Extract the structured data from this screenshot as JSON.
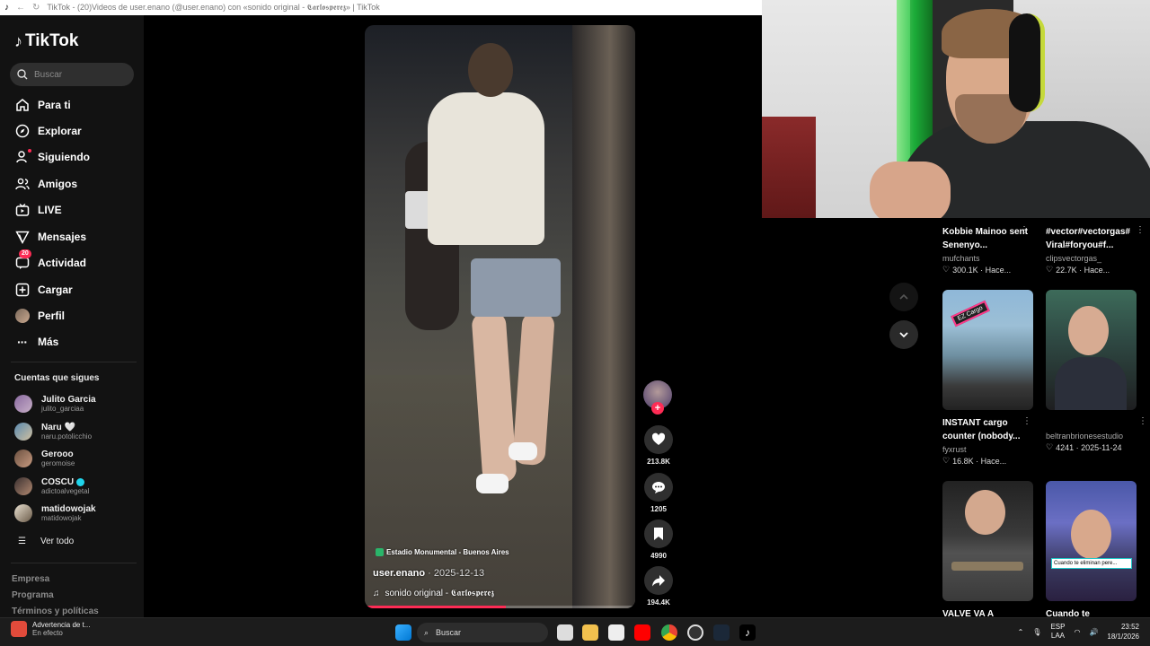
{
  "browser": {
    "title": "TikTok - (20)Videos de user.enano (@user.enano) con «sonido original - 𝕮𝖆𝖗𝖑𝖔𝖘𝖕𝖊𝖗𝖊𝖟» | TikTok"
  },
  "sidebar": {
    "logo": "TikTok",
    "search_placeholder": "Buscar",
    "nav": [
      {
        "label": "Para ti",
        "icon": "home-icon"
      },
      {
        "label": "Explorar",
        "icon": "compass-icon"
      },
      {
        "label": "Siguiendo",
        "icon": "user-follow-icon"
      },
      {
        "label": "Amigos",
        "icon": "friends-icon"
      },
      {
        "label": "LIVE",
        "icon": "live-tv-icon"
      },
      {
        "label": "Mensajes",
        "icon": "send-icon"
      },
      {
        "label": "Actividad",
        "icon": "activity-icon",
        "badge": "20"
      },
      {
        "label": "Cargar",
        "icon": "upload-plus-icon"
      },
      {
        "label": "Perfil",
        "icon": "profile-avatar-icon"
      },
      {
        "label": "Más",
        "icon": "more-dots-icon"
      }
    ],
    "following_title": "Cuentas que sigues",
    "following": [
      {
        "name": "Julito Garcia",
        "user": "julito_garciaa"
      },
      {
        "name": "Naru 🤍",
        "user": "naru.potolicchio"
      },
      {
        "name": "Gerooo",
        "user": "geromoise"
      },
      {
        "name": "COSCU",
        "user": "adictoalvegetal",
        "verified": true
      },
      {
        "name": "matidowojak",
        "user": "matidowojak"
      }
    ],
    "see_all": "Ver todo",
    "footer": [
      "Empresa",
      "Programa",
      "Términos y políticas"
    ]
  },
  "video": {
    "location": "Estadio Monumental - Buenos Aires",
    "username": "user.enano",
    "date": " · 2025-12-13",
    "sound": "sonido original - 𝕮𝖆𝖗𝖑𝖔𝖘𝖕𝖊𝖗𝖊𝖟",
    "progress": 0.52
  },
  "actions": {
    "likes": "213.8K",
    "comments": "1205",
    "saves": "4990",
    "shares": "194.4K"
  },
  "grid": [
    {
      "title": "Kobbie Mainoo sent Senenyo...",
      "user": "mufchants",
      "stats": "300.1K · Hace..."
    },
    {
      "title": "#vector#vectorgas#Viral#foryou#f...",
      "user": "clipsvectorgas_",
      "stats": "22.7K · Hace..."
    },
    {
      "title": "INSTANT cargo counter (nobody...",
      "user": "fyxrust",
      "stats": "16.8K · Hace...",
      "overlay": "EZ Cargo"
    },
    {
      "title": "",
      "user": "beltranbrionesestudio",
      "stats": "4241 · 2025-11-24"
    },
    {
      "title": "VALVE VA A",
      "user": "",
      "stats": ""
    },
    {
      "title": "Cuando te",
      "user": "",
      "stats": "",
      "overlay": "Cuando te eliminan pere..."
    }
  ],
  "taskbar": {
    "alert_title": "Advertencia de t...",
    "alert_sub": "En efecto",
    "search": "Buscar",
    "lang1": "ESP",
    "lang2": "LAA",
    "time": "23:52",
    "date": "18/1/2026"
  }
}
